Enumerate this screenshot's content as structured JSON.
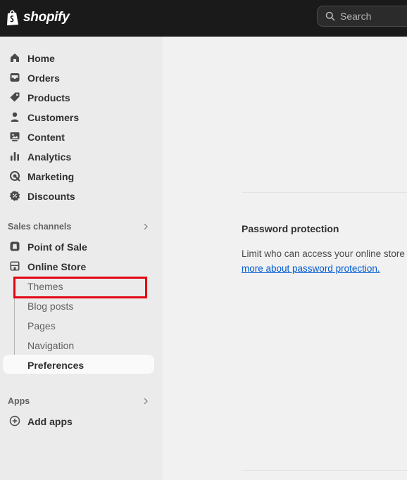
{
  "app": {
    "brand": "shopify",
    "search_placeholder": "Search"
  },
  "sidebar": {
    "items": [
      {
        "label": "Home",
        "icon": "home-icon"
      },
      {
        "label": "Orders",
        "icon": "inbox-icon"
      },
      {
        "label": "Products",
        "icon": "tag-icon"
      },
      {
        "label": "Customers",
        "icon": "person-icon"
      },
      {
        "label": "Content",
        "icon": "image-icon"
      },
      {
        "label": "Analytics",
        "icon": "bar-chart-icon"
      },
      {
        "label": "Marketing",
        "icon": "target-icon"
      },
      {
        "label": "Discounts",
        "icon": "discount-icon"
      }
    ],
    "sales_channels_label": "Sales channels",
    "channels": [
      {
        "label": "Point of Sale",
        "icon": "pos-icon"
      },
      {
        "label": "Online Store",
        "icon": "store-icon"
      }
    ],
    "online_store_subitems": [
      {
        "label": "Themes"
      },
      {
        "label": "Blog posts"
      },
      {
        "label": "Pages"
      },
      {
        "label": "Navigation"
      },
      {
        "label": "Preferences"
      }
    ],
    "apps_label": "Apps",
    "add_apps_label": "Add apps"
  },
  "main": {
    "password_protection_title": "Password protection",
    "password_protection_desc": "Limit who can access your online store",
    "password_protection_link": "more about password protection."
  },
  "colors": {
    "topbar": "#1a1a1a",
    "sidebar": "#ebebeb",
    "main_bg": "#f1f1f1",
    "link": "#005bd3",
    "highlight": "#e30613"
  }
}
